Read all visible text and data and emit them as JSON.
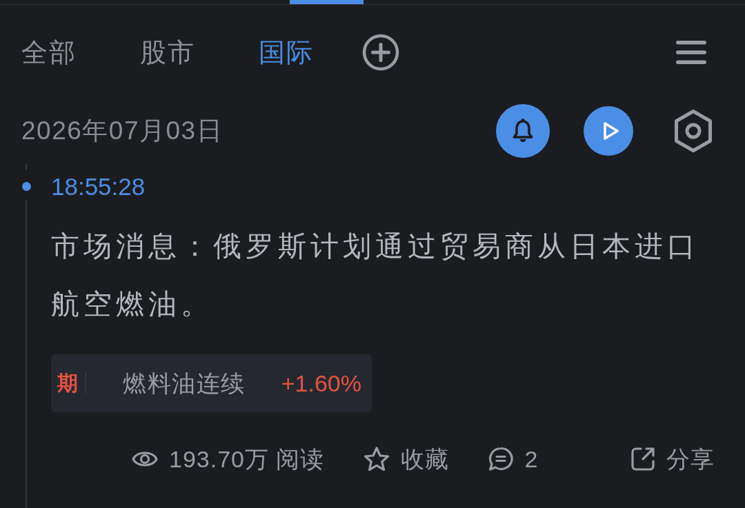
{
  "tabs": [
    {
      "label": "全部",
      "selected": false
    },
    {
      "label": "股市",
      "selected": false
    },
    {
      "label": "国际",
      "selected": true
    }
  ],
  "date": "2026年07月03日",
  "news": [
    {
      "time": "18:55:28",
      "text": "市场消息：俄罗斯计划通过贸易商从日本进口航空燃油。",
      "tags": [
        {
          "badge": "期",
          "name": "燃料油连续",
          "change": "+1.60%",
          "rising": true
        }
      ],
      "stats": [
        {
          "kind": "views",
          "label": "193.70万 阅读"
        },
        {
          "kind": "favorite",
          "label": "收藏"
        },
        {
          "kind": "comments",
          "label": "2"
        },
        {
          "kind": "share",
          "label": "分享"
        }
      ]
    }
  ]
}
